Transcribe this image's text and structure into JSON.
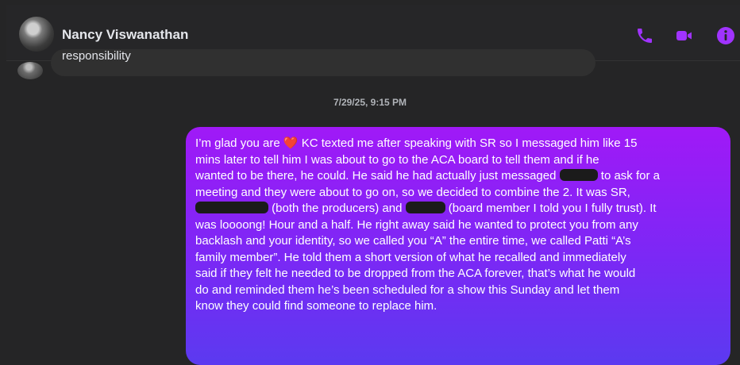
{
  "header": {
    "contact_name": "Nancy Viswanathan",
    "icons": [
      "phone-icon",
      "video-call-icon",
      "info-icon"
    ],
    "accent_color": "#a033ff"
  },
  "previous_message": {
    "text": "responsibility"
  },
  "timestamp": "7/29/25, 9:15 PM",
  "message": {
    "lines": [
      {
        "parts": [
          {
            "t": "I’m glad you are "
          },
          {
            "emoji": "❤️"
          },
          {
            "t": " KC texted me after speaking with SR so I messaged him like 15"
          }
        ]
      },
      {
        "parts": [
          {
            "t": "mins later to tell him I was about to go to the ACA board to tell them and if he"
          }
        ]
      },
      {
        "parts": [
          {
            "t": "wanted to be there, he could. He said he had actually just messaged "
          },
          {
            "redacted": true
          },
          {
            "t": " to ask for a"
          }
        ]
      },
      {
        "parts": [
          {
            "t": "meeting and they were about to go on, so we decided to combine the 2. It was SR,"
          }
        ]
      },
      {
        "parts": [
          {
            "redacted": true
          },
          {
            "t": " (both the producers) and "
          },
          {
            "redacted": true
          },
          {
            "t": " (board member I told you I fully trust). It"
          }
        ]
      },
      {
        "parts": [
          {
            "t": "was loooong! Hour and a half. He right away said he wanted to protect you from any"
          }
        ]
      },
      {
        "parts": [
          {
            "t": "backlash and your identity, so we called you “A” the entire time, we called Patti “A’s"
          }
        ]
      },
      {
        "parts": [
          {
            "t": "family member”. He told them a short version of what he recalled and immediately"
          }
        ]
      },
      {
        "parts": [
          {
            "t": "said if they felt he needed to be dropped from the ACA forever, that’s what he would"
          }
        ]
      },
      {
        "parts": [
          {
            "t": "do and reminded them he’s been scheduled for a show this Sunday and let them"
          }
        ]
      },
      {
        "parts": [
          {
            "t": "know they could find someone to replace him."
          }
        ]
      }
    ],
    "bubble_colors": [
      "#a019f7",
      "#5b3af0"
    ]
  }
}
